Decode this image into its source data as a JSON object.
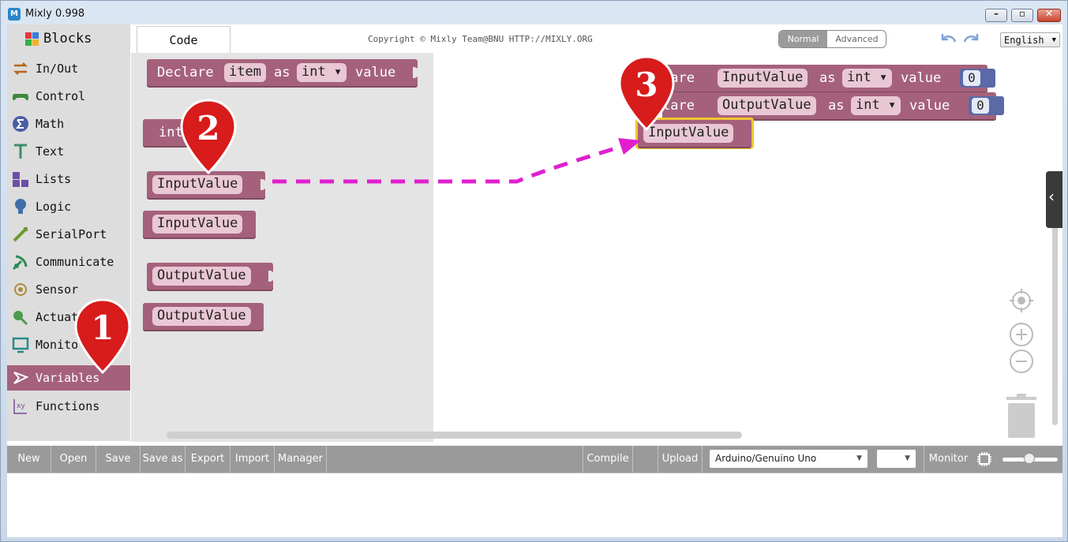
{
  "window": {
    "title": "Mixly 0.998",
    "minimize_label": "–",
    "maximize_label": "▫",
    "close_label": "✕"
  },
  "sidebar": {
    "brand": "Blocks",
    "items": [
      {
        "label": "In/Out",
        "icon": "arrows-icon"
      },
      {
        "label": "Control",
        "icon": "gamepad-icon"
      },
      {
        "label": "Math",
        "icon": "sigma-icon"
      },
      {
        "label": "Text",
        "icon": "text-icon"
      },
      {
        "label": "Lists",
        "icon": "lists-icon"
      },
      {
        "label": "Logic",
        "icon": "bulb-icon"
      },
      {
        "label": "SerialPort",
        "icon": "usb-icon"
      },
      {
        "label": "Communicate",
        "icon": "satellite-icon"
      },
      {
        "label": "Sensor",
        "icon": "sensor-icon"
      },
      {
        "label": "Actuat",
        "icon": "actuator-icon"
      },
      {
        "label": "Monito",
        "icon": "monitor-icon"
      },
      {
        "label": "Variables",
        "icon": "variables-icon"
      },
      {
        "label": "Functions",
        "icon": "functions-icon"
      }
    ],
    "selected": "Variables"
  },
  "header": {
    "tab": "Code",
    "copyright": "Copyright © Mixly Team@BNU HTTP://MIXLY.ORG",
    "mode_normal": "Normal",
    "mode_advanced": "Advanced",
    "language": "English",
    "language_arrow": "▼"
  },
  "flyout": {
    "declare": {
      "word_declare": "Declare",
      "name": "item",
      "word_as": "as",
      "type": "int ▾",
      "word_value": "value"
    },
    "int_block": "int",
    "getter1": "InputValue",
    "setter1": "InputValue",
    "getter2": "OutputValue",
    "setter2": "OutputValue"
  },
  "workspace": {
    "declare1": {
      "prefix": "lare",
      "name": "InputValue",
      "word_as": "as",
      "type": "int ▾",
      "word_value": "value",
      "initial": "0"
    },
    "declare2": {
      "prefix": "lare",
      "name": "OutputValue",
      "word_as": "as",
      "type": "int ▾",
      "word_value": "value",
      "initial": "0"
    },
    "selected_block": "InputValue",
    "collapse_arrow": "‹"
  },
  "toolbar": {
    "new": "New",
    "open": "Open",
    "save": "Save",
    "save_as": "Save as",
    "export": "Export",
    "import": "Import",
    "manager": "Manager",
    "compile": "Compile",
    "upload": "Upload",
    "board": "Arduino/Genuino Uno",
    "port": "",
    "dropdown_arrow": "▼",
    "monitor": "Monitor"
  },
  "annotations": [
    {
      "number": "1"
    },
    {
      "number": "2"
    },
    {
      "number": "3"
    }
  ],
  "colors": {
    "variable_block": "#a5617b",
    "number_block": "#5b69a7",
    "selection": "#f2c531",
    "arrow": "#e01fcf",
    "pin": "#d81b1b"
  }
}
